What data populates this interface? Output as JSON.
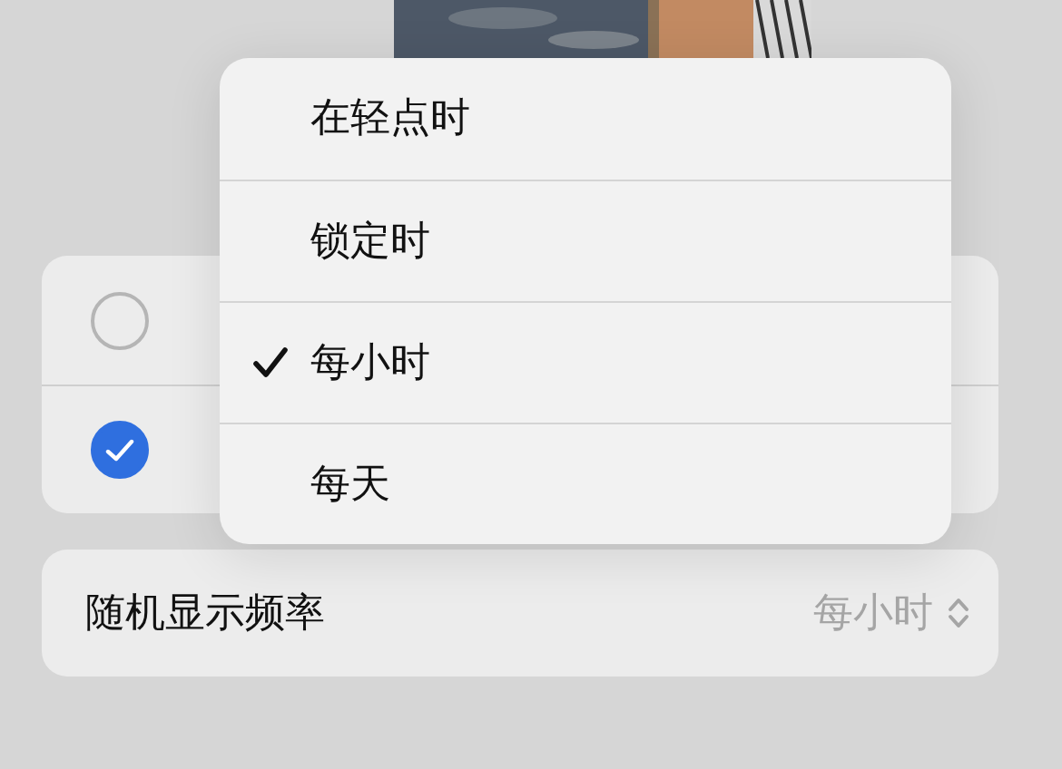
{
  "options": [
    {
      "selected": false
    },
    {
      "selected": true
    }
  ],
  "frequency_row": {
    "label": "随机显示频率",
    "value": "每小时"
  },
  "menu": [
    {
      "label": "在轻点时",
      "checked": false
    },
    {
      "label": "锁定时",
      "checked": false
    },
    {
      "label": "每小时",
      "checked": true
    },
    {
      "label": "每天",
      "checked": false
    }
  ]
}
